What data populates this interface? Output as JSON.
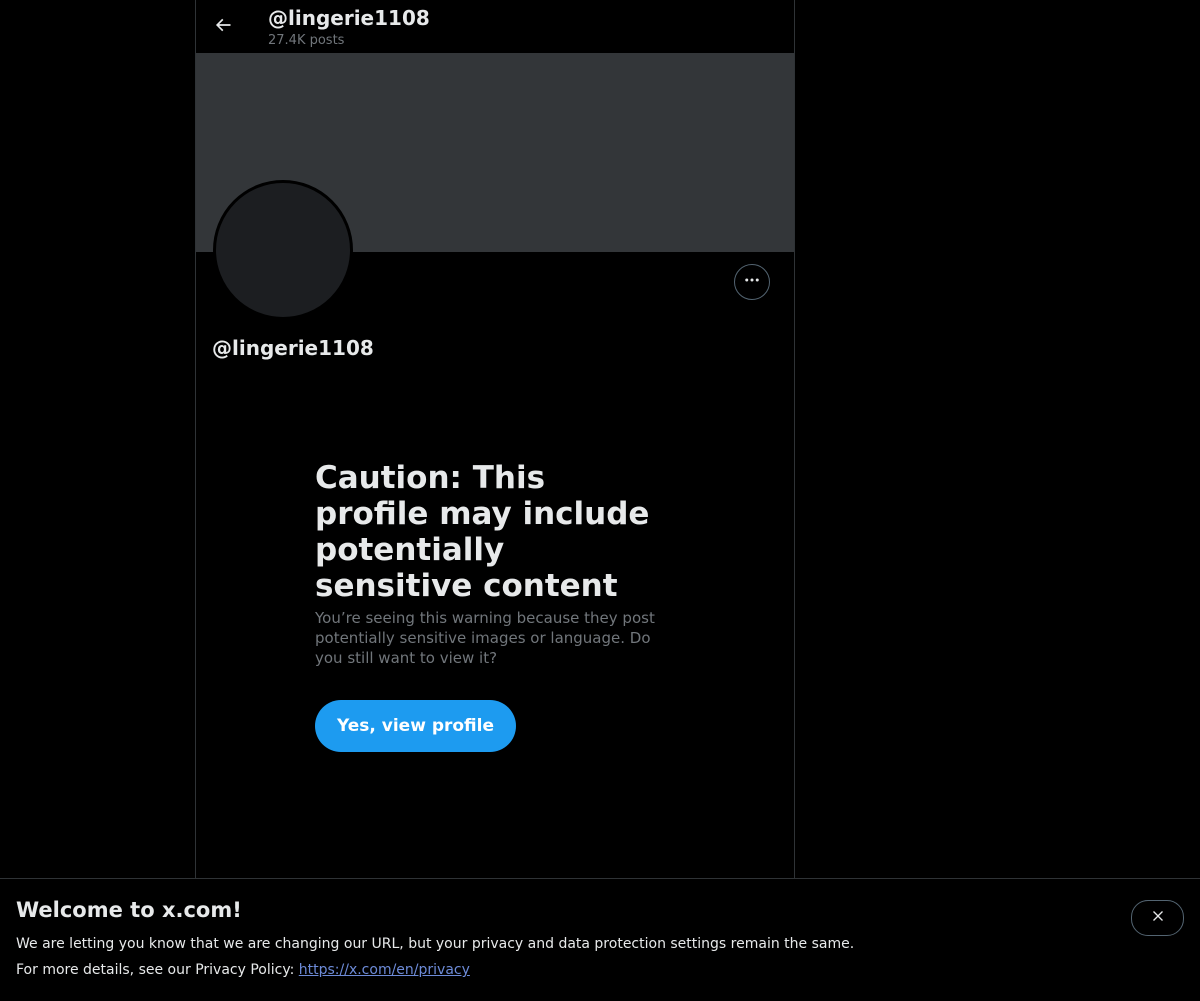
{
  "header": {
    "title": "@lingerie1108",
    "post_count": "27.4K posts",
    "back_icon": "arrow-left-icon"
  },
  "profile": {
    "handle": "@lingerie1108",
    "more_icon": "more-horizontal-icon",
    "banner_color": "#333639",
    "avatar_color": "#1c1e21"
  },
  "caution": {
    "title": "Caution: This profile may include potentially sensitive content",
    "message": "You’re seeing this warning because they post potentially sensitive images or language. Do you still want to view it?",
    "button_label": "Yes, view profile"
  },
  "notice": {
    "title": "Welcome to x.com!",
    "line1": "We are letting you know that we are changing our URL, but your privacy and data protection settings remain the same.",
    "line2_prefix": "For more details, see our Privacy Policy: ",
    "link_text": "https://x.com/en/privacy",
    "close_icon": "close-icon"
  },
  "colors": {
    "background": "#000000",
    "accent": "#1d9bf0",
    "text_primary": "#e7e9ea",
    "text_secondary": "#71767b",
    "link": "#6d8bd8"
  }
}
